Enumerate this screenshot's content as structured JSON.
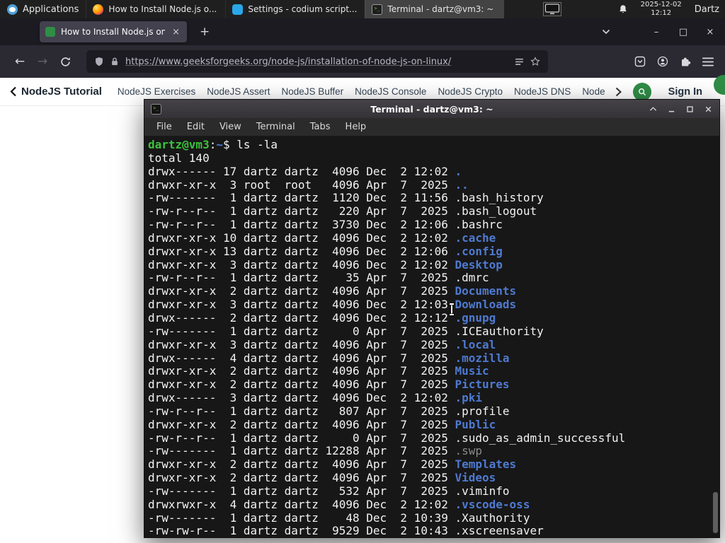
{
  "panel": {
    "applications": "Applications",
    "window_buttons": [
      {
        "icon": "firefox",
        "label": "How to Install Node.js o...",
        "active": false
      },
      {
        "icon": "codium",
        "label": "Settings - codium script...",
        "active": false
      },
      {
        "icon": "terminal",
        "label": "Terminal - dartz@vm3: ~",
        "active": true
      }
    ],
    "clock": {
      "date": "2025-12-02",
      "time": "12:12"
    },
    "user": "Dartz"
  },
  "browser": {
    "tab_title": "How to Install Node.js on",
    "url": "https://www.geeksforgeeks.org/node-js/installation-of-node-js-on-linux/"
  },
  "site_nav": {
    "brand": "NodeJS Tutorial",
    "links": [
      "NodeJS Exercises",
      "NodeJS Assert",
      "NodeJS Buffer",
      "NodeJS Console",
      "NodeJS Crypto",
      "NodeJS DNS",
      "Node"
    ],
    "sign_in": "Sign In"
  },
  "glyphs": {
    "close": "×",
    "plus": "+",
    "minimize": "–",
    "maximize": "□",
    "back": "←",
    "forward": "→"
  },
  "colors": {
    "gfg_green": "#2f8d46",
    "panel_bg": "#1f1f1f",
    "firefox_tab_bg": "#42414d",
    "terminal_bg": "#171717",
    "terminal_dir_blue": "#4e7ad1",
    "terminal_prompt_green": "#3cc23c",
    "terminal_dim_gray": "#8a8a8a"
  },
  "terminal": {
    "title": "Terminal - dartz@vm3: ~",
    "menu": [
      "File",
      "Edit",
      "View",
      "Terminal",
      "Tabs",
      "Help"
    ],
    "lines": [
      [
        [
          "dartz@vm3",
          "usr"
        ],
        [
          ":",
          "fg"
        ],
        [
          "~",
          "path"
        ],
        [
          "$ ls -la",
          "fg"
        ]
      ],
      [
        [
          "total 140",
          "fg"
        ]
      ],
      [
        [
          "drwx------ 17 dartz dartz  4096 Dec  2 12:02 ",
          "fg"
        ],
        [
          ".",
          "dir"
        ]
      ],
      [
        [
          "drwxr-xr-x  3 root  root   4096 Apr  7  2025 ",
          "fg"
        ],
        [
          "..",
          "dir"
        ]
      ],
      [
        [
          "-rw-------  1 dartz dartz  1120 Dec  2 11:56 ",
          "fg"
        ],
        [
          ".bash_history",
          "fg"
        ]
      ],
      [
        [
          "-rw-r--r--  1 dartz dartz   220 Apr  7  2025 ",
          "fg"
        ],
        [
          ".bash_logout",
          "fg"
        ]
      ],
      [
        [
          "-rw-r--r--  1 dartz dartz  3730 Dec  2 12:06 ",
          "fg"
        ],
        [
          ".bashrc",
          "fg"
        ]
      ],
      [
        [
          "drwxr-xr-x 10 dartz dartz  4096 Dec  2 12:02 ",
          "fg"
        ],
        [
          ".cache",
          "dir"
        ]
      ],
      [
        [
          "drwxr-xr-x 13 dartz dartz  4096 Dec  2 12:06 ",
          "fg"
        ],
        [
          ".config",
          "dir"
        ]
      ],
      [
        [
          "drwxr-xr-x  3 dartz dartz  4096 Dec  2 12:02 ",
          "fg"
        ],
        [
          "Desktop",
          "dir"
        ]
      ],
      [
        [
          "-rw-r--r--  1 dartz dartz    35 Apr  7  2025 ",
          "fg"
        ],
        [
          ".dmrc",
          "fg"
        ]
      ],
      [
        [
          "drwxr-xr-x  2 dartz dartz  4096 Apr  7  2025 ",
          "fg"
        ],
        [
          "Documents",
          "dir"
        ]
      ],
      [
        [
          "drwxr-xr-x  3 dartz dartz  4096 Dec  2 12:03 ",
          "fg"
        ],
        [
          "Downloads",
          "dir"
        ]
      ],
      [
        [
          "drwx------  2 dartz dartz  4096 Dec  2 12:12 ",
          "fg"
        ],
        [
          ".gnupg",
          "dir"
        ]
      ],
      [
        [
          "-rw-------  1 dartz dartz     0 Apr  7  2025 ",
          "fg"
        ],
        [
          ".ICEauthority",
          "fg"
        ]
      ],
      [
        [
          "drwxr-xr-x  3 dartz dartz  4096 Apr  7  2025 ",
          "fg"
        ],
        [
          ".local",
          "dir"
        ]
      ],
      [
        [
          "drwx------  4 dartz dartz  4096 Apr  7  2025 ",
          "fg"
        ],
        [
          ".mozilla",
          "dir"
        ]
      ],
      [
        [
          "drwxr-xr-x  2 dartz dartz  4096 Apr  7  2025 ",
          "fg"
        ],
        [
          "Music",
          "dir"
        ]
      ],
      [
        [
          "drwxr-xr-x  2 dartz dartz  4096 Apr  7  2025 ",
          "fg"
        ],
        [
          "Pictures",
          "dir"
        ]
      ],
      [
        [
          "drwx------  3 dartz dartz  4096 Dec  2 12:02 ",
          "fg"
        ],
        [
          ".pki",
          "dir"
        ]
      ],
      [
        [
          "-rw-r--r--  1 dartz dartz   807 Apr  7  2025 ",
          "fg"
        ],
        [
          ".profile",
          "fg"
        ]
      ],
      [
        [
          "drwxr-xr-x  2 dartz dartz  4096 Apr  7  2025 ",
          "fg"
        ],
        [
          "Public",
          "dir"
        ]
      ],
      [
        [
          "-rw-r--r--  1 dartz dartz     0 Apr  7  2025 ",
          "fg"
        ],
        [
          ".sudo_as_admin_successful",
          "fg"
        ]
      ],
      [
        [
          "-rw-------  1 dartz dartz 12288 Apr  7  2025 ",
          "fg"
        ],
        [
          ".swp",
          "dim"
        ]
      ],
      [
        [
          "drwxr-xr-x  2 dartz dartz  4096 Apr  7  2025 ",
          "fg"
        ],
        [
          "Templates",
          "dir"
        ]
      ],
      [
        [
          "drwxr-xr-x  2 dartz dartz  4096 Apr  7  2025 ",
          "fg"
        ],
        [
          "Videos",
          "dir"
        ]
      ],
      [
        [
          "-rw-------  1 dartz dartz   532 Apr  7  2025 ",
          "fg"
        ],
        [
          ".viminfo",
          "fg"
        ]
      ],
      [
        [
          "drwxrwxr-x  4 dartz dartz  4096 Dec  2 12:02 ",
          "fg"
        ],
        [
          ".vscode-oss",
          "dir"
        ]
      ],
      [
        [
          "-rw-------  1 dartz dartz    48 Dec  2 10:39 ",
          "fg"
        ],
        [
          ".Xauthority",
          "fg"
        ]
      ],
      [
        [
          "-rw-rw-r--  1 dartz dartz  9529 Dec  2 10:43 ",
          "fg"
        ],
        [
          ".xscreensaver",
          "fg"
        ]
      ]
    ]
  }
}
